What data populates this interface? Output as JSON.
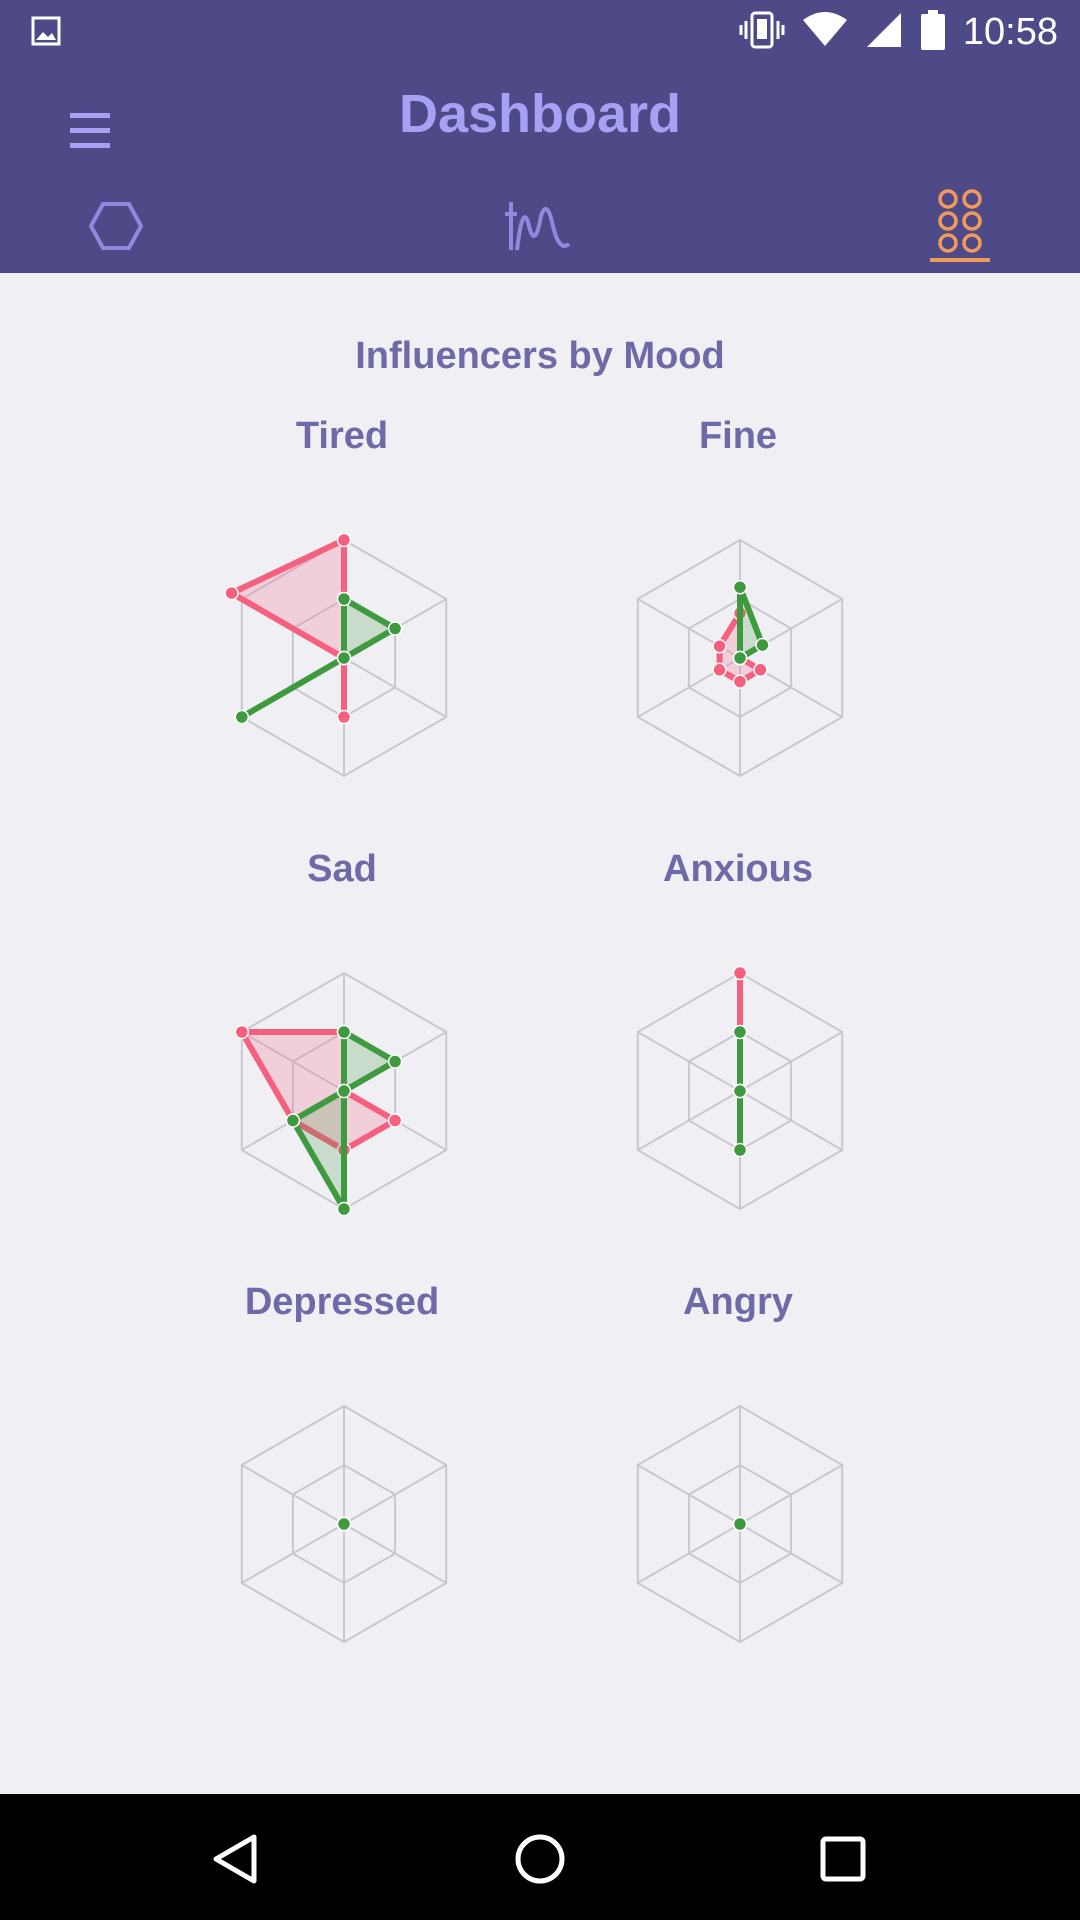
{
  "status_bar": {
    "time": "10:58",
    "icons": [
      "image-icon",
      "vibrate-icon",
      "wifi-icon",
      "signal-icon",
      "battery-icon"
    ]
  },
  "app_bar": {
    "title": "Dashboard",
    "menu_icon": "hamburger-icon",
    "tabs": [
      {
        "icon": "hexagon-icon",
        "active": false
      },
      {
        "icon": "wave-chart-icon",
        "active": false
      },
      {
        "icon": "influencers-grid-icon",
        "active": true
      }
    ]
  },
  "colors": {
    "app_bar": "#4e4a88",
    "title": "#a6a1f3",
    "label": "#6e6aa8",
    "active_tab": "#f29a5b",
    "negative": "#f5607f",
    "positive": "#3f9a3f",
    "grid": "#c9c8cf"
  },
  "section": {
    "title": "Influencers by Mood"
  },
  "chart_data": [
    {
      "type": "radar",
      "title": "Tired",
      "axes": 6,
      "negative": [
        1,
        0,
        0,
        0.5,
        0,
        1.1
      ],
      "positive": [
        0.5,
        0.5,
        0,
        0,
        1,
        0
      ]
    },
    {
      "type": "radar",
      "title": "Fine",
      "axes": 6,
      "negative": [
        0.38,
        0,
        0.2,
        0.2,
        0.2,
        0.2
      ],
      "positive": [
        0.6,
        0.22,
        0,
        0,
        0,
        0
      ]
    },
    {
      "type": "radar",
      "title": "Sad",
      "axes": 6,
      "negative": [
        0.5,
        0,
        0.5,
        0.5,
        0.5,
        1
      ],
      "positive": [
        0.5,
        0.5,
        0,
        1,
        0.5,
        0
      ]
    },
    {
      "type": "radar",
      "title": "Anxious",
      "axes": 6,
      "negative": [
        1,
        0,
        0,
        0,
        0,
        0
      ],
      "positive": [
        0.5,
        0,
        0,
        0.5,
        0,
        0
      ]
    },
    {
      "type": "radar",
      "title": "Depressed",
      "axes": 6,
      "negative": [
        0,
        0,
        0,
        0,
        0,
        0
      ],
      "positive": [
        0,
        0,
        0,
        0,
        0,
        0
      ]
    },
    {
      "type": "radar",
      "title": "Angry",
      "axes": 6,
      "negative": [
        0,
        0,
        0,
        0,
        0,
        0
      ],
      "positive": [
        0,
        0,
        0,
        0,
        0,
        0
      ]
    }
  ],
  "navbar": {
    "buttons": [
      "back-icon",
      "home-icon",
      "recents-icon"
    ]
  }
}
